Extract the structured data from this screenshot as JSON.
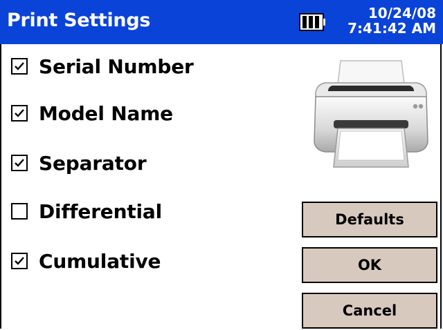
{
  "title_bar": {
    "title": "Print Settings",
    "date": "10/24/08",
    "time": "7:41:42 AM"
  },
  "options": [
    {
      "label": "Serial Number",
      "checked": true
    },
    {
      "label": "Model Name",
      "checked": true
    },
    {
      "label": "Separator",
      "checked": true
    },
    {
      "label": "Differential",
      "checked": false
    },
    {
      "label": "Cumulative",
      "checked": true
    }
  ],
  "buttons": {
    "defaults": "Defaults",
    "ok": "OK",
    "cancel": "Cancel"
  },
  "icons": {
    "battery": "battery-icon",
    "printer": "printer-icon"
  },
  "colors": {
    "title_bar": "#0a43d8",
    "button_face": "#d8c9bf"
  }
}
